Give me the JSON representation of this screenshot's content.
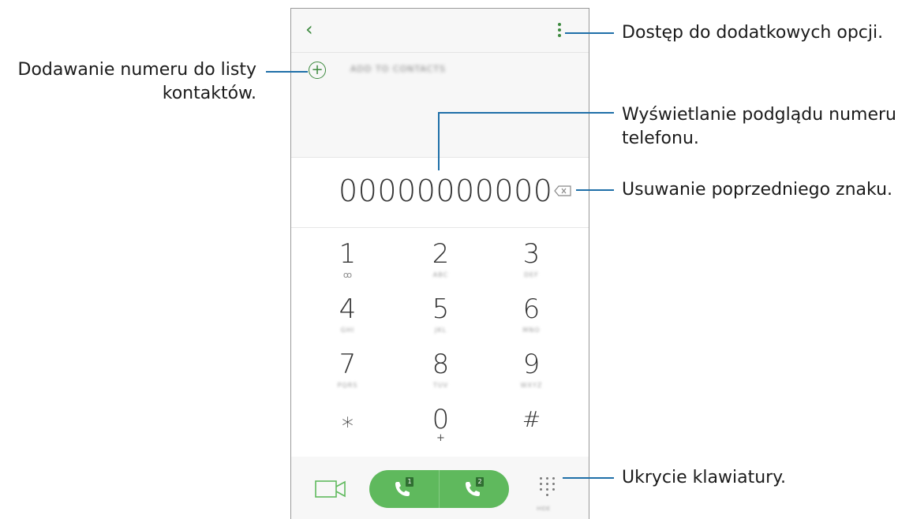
{
  "phone": {
    "back_icon": "chevron-left-icon",
    "more_icon": "more-vertical-icon",
    "add_to_contacts_label": "ADD TO CONTACTS",
    "number": "00000000000",
    "keys": [
      {
        "digit": "1",
        "letters": "",
        "sub": "voicemail-icon"
      },
      {
        "digit": "2",
        "letters": "ABC"
      },
      {
        "digit": "3",
        "letters": "DEF"
      },
      {
        "digit": "4",
        "letters": "GHI"
      },
      {
        "digit": "5",
        "letters": "JKL"
      },
      {
        "digit": "6",
        "letters": "MNO"
      },
      {
        "digit": "7",
        "letters": "PQRS"
      },
      {
        "digit": "8",
        "letters": "TUV"
      },
      {
        "digit": "9",
        "letters": "WXYZ"
      },
      {
        "digit": "⁎",
        "letters": ""
      },
      {
        "digit": "0",
        "letters": "+"
      },
      {
        "digit": "#",
        "letters": ""
      }
    ],
    "sim1": "1",
    "sim2": "2",
    "hide_label": "HIDE",
    "accent_color": "#5fb95d"
  },
  "annotations": {
    "add_number": [
      "Dodawanie numeru do listy",
      "kontaktów."
    ],
    "more_options": "Dostęp do dodatkowych opcji.",
    "preview": [
      "Wyświetlanie podglądu numeru",
      "telefonu."
    ],
    "delete": "Usuwanie poprzedniego znaku.",
    "hide_keypad": "Ukrycie klawiatury."
  }
}
